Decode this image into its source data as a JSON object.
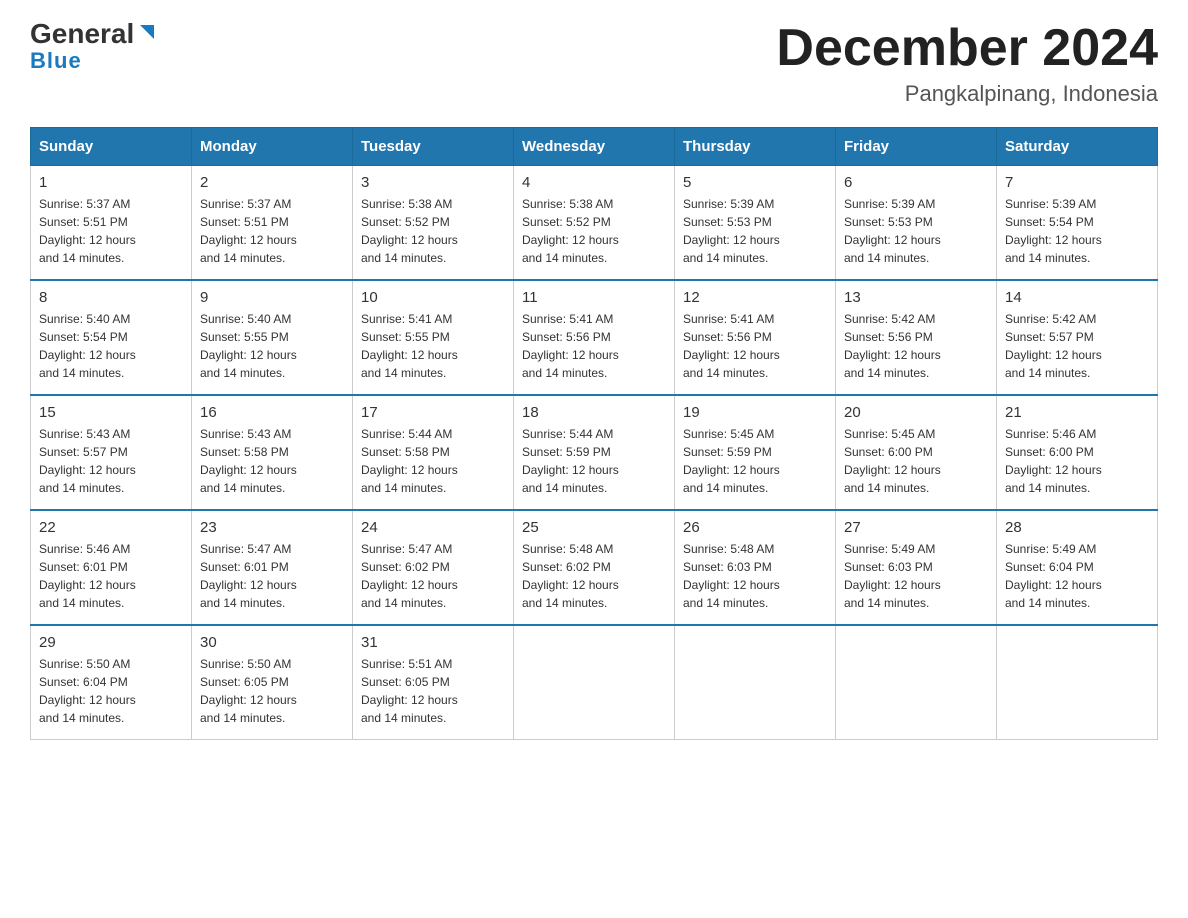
{
  "header": {
    "logo_general": "General",
    "logo_blue": "Blue",
    "month_title": "December 2024",
    "location": "Pangkalpinang, Indonesia"
  },
  "days_of_week": [
    "Sunday",
    "Monday",
    "Tuesday",
    "Wednesday",
    "Thursday",
    "Friday",
    "Saturday"
  ],
  "weeks": [
    [
      {
        "day": "1",
        "sunrise": "5:37 AM",
        "sunset": "5:51 PM",
        "daylight": "12 hours and 14 minutes."
      },
      {
        "day": "2",
        "sunrise": "5:37 AM",
        "sunset": "5:51 PM",
        "daylight": "12 hours and 14 minutes."
      },
      {
        "day": "3",
        "sunrise": "5:38 AM",
        "sunset": "5:52 PM",
        "daylight": "12 hours and 14 minutes."
      },
      {
        "day": "4",
        "sunrise": "5:38 AM",
        "sunset": "5:52 PM",
        "daylight": "12 hours and 14 minutes."
      },
      {
        "day": "5",
        "sunrise": "5:39 AM",
        "sunset": "5:53 PM",
        "daylight": "12 hours and 14 minutes."
      },
      {
        "day": "6",
        "sunrise": "5:39 AM",
        "sunset": "5:53 PM",
        "daylight": "12 hours and 14 minutes."
      },
      {
        "day": "7",
        "sunrise": "5:39 AM",
        "sunset": "5:54 PM",
        "daylight": "12 hours and 14 minutes."
      }
    ],
    [
      {
        "day": "8",
        "sunrise": "5:40 AM",
        "sunset": "5:54 PM",
        "daylight": "12 hours and 14 minutes."
      },
      {
        "day": "9",
        "sunrise": "5:40 AM",
        "sunset": "5:55 PM",
        "daylight": "12 hours and 14 minutes."
      },
      {
        "day": "10",
        "sunrise": "5:41 AM",
        "sunset": "5:55 PM",
        "daylight": "12 hours and 14 minutes."
      },
      {
        "day": "11",
        "sunrise": "5:41 AM",
        "sunset": "5:56 PM",
        "daylight": "12 hours and 14 minutes."
      },
      {
        "day": "12",
        "sunrise": "5:41 AM",
        "sunset": "5:56 PM",
        "daylight": "12 hours and 14 minutes."
      },
      {
        "day": "13",
        "sunrise": "5:42 AM",
        "sunset": "5:56 PM",
        "daylight": "12 hours and 14 minutes."
      },
      {
        "day": "14",
        "sunrise": "5:42 AM",
        "sunset": "5:57 PM",
        "daylight": "12 hours and 14 minutes."
      }
    ],
    [
      {
        "day": "15",
        "sunrise": "5:43 AM",
        "sunset": "5:57 PM",
        "daylight": "12 hours and 14 minutes."
      },
      {
        "day": "16",
        "sunrise": "5:43 AM",
        "sunset": "5:58 PM",
        "daylight": "12 hours and 14 minutes."
      },
      {
        "day": "17",
        "sunrise": "5:44 AM",
        "sunset": "5:58 PM",
        "daylight": "12 hours and 14 minutes."
      },
      {
        "day": "18",
        "sunrise": "5:44 AM",
        "sunset": "5:59 PM",
        "daylight": "12 hours and 14 minutes."
      },
      {
        "day": "19",
        "sunrise": "5:45 AM",
        "sunset": "5:59 PM",
        "daylight": "12 hours and 14 minutes."
      },
      {
        "day": "20",
        "sunrise": "5:45 AM",
        "sunset": "6:00 PM",
        "daylight": "12 hours and 14 minutes."
      },
      {
        "day": "21",
        "sunrise": "5:46 AM",
        "sunset": "6:00 PM",
        "daylight": "12 hours and 14 minutes."
      }
    ],
    [
      {
        "day": "22",
        "sunrise": "5:46 AM",
        "sunset": "6:01 PM",
        "daylight": "12 hours and 14 minutes."
      },
      {
        "day": "23",
        "sunrise": "5:47 AM",
        "sunset": "6:01 PM",
        "daylight": "12 hours and 14 minutes."
      },
      {
        "day": "24",
        "sunrise": "5:47 AM",
        "sunset": "6:02 PM",
        "daylight": "12 hours and 14 minutes."
      },
      {
        "day": "25",
        "sunrise": "5:48 AM",
        "sunset": "6:02 PM",
        "daylight": "12 hours and 14 minutes."
      },
      {
        "day": "26",
        "sunrise": "5:48 AM",
        "sunset": "6:03 PM",
        "daylight": "12 hours and 14 minutes."
      },
      {
        "day": "27",
        "sunrise": "5:49 AM",
        "sunset": "6:03 PM",
        "daylight": "12 hours and 14 minutes."
      },
      {
        "day": "28",
        "sunrise": "5:49 AM",
        "sunset": "6:04 PM",
        "daylight": "12 hours and 14 minutes."
      }
    ],
    [
      {
        "day": "29",
        "sunrise": "5:50 AM",
        "sunset": "6:04 PM",
        "daylight": "12 hours and 14 minutes."
      },
      {
        "day": "30",
        "sunrise": "5:50 AM",
        "sunset": "6:05 PM",
        "daylight": "12 hours and 14 minutes."
      },
      {
        "day": "31",
        "sunrise": "5:51 AM",
        "sunset": "6:05 PM",
        "daylight": "12 hours and 14 minutes."
      },
      {
        "day": "",
        "sunrise": "",
        "sunset": "",
        "daylight": ""
      },
      {
        "day": "",
        "sunrise": "",
        "sunset": "",
        "daylight": ""
      },
      {
        "day": "",
        "sunrise": "",
        "sunset": "",
        "daylight": ""
      },
      {
        "day": "",
        "sunrise": "",
        "sunset": "",
        "daylight": ""
      }
    ]
  ],
  "labels": {
    "sunrise_prefix": "Sunrise: ",
    "sunset_prefix": "Sunset: ",
    "daylight_prefix": "Daylight: "
  }
}
